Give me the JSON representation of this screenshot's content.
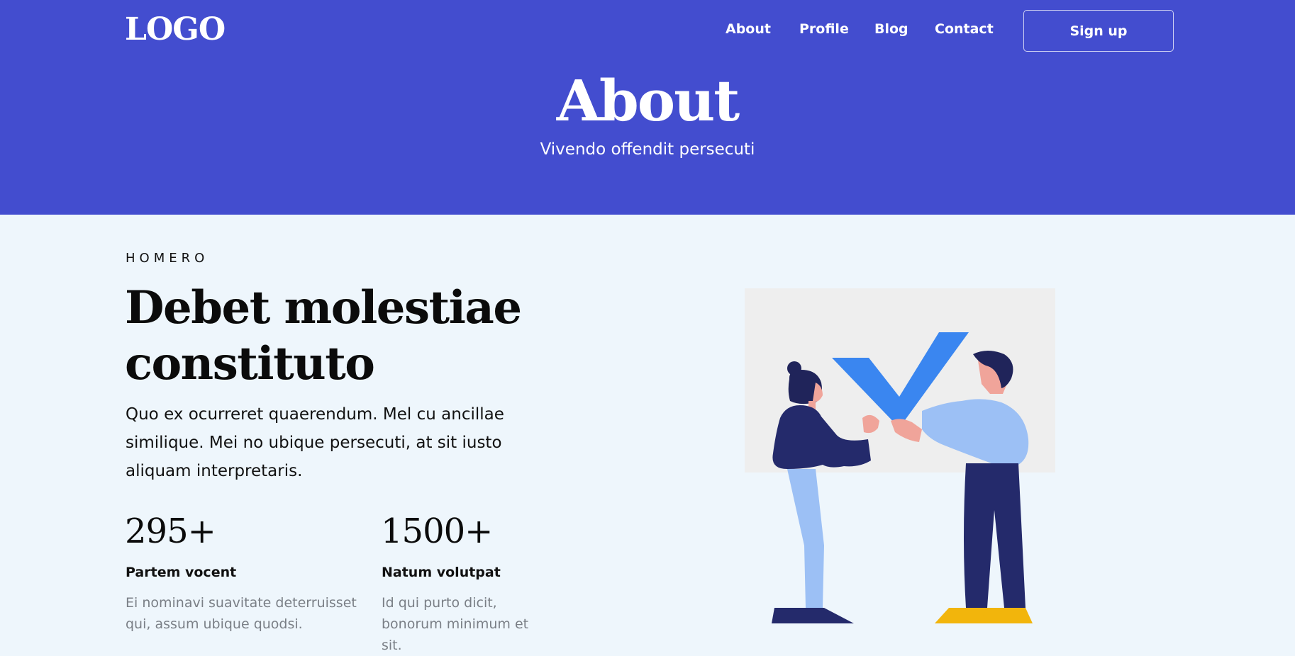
{
  "header": {
    "logo": "LOGO",
    "nav": [
      "About",
      "Profile",
      "Blog",
      "Contact"
    ],
    "signup_label": "Sign up"
  },
  "hero": {
    "title": "About",
    "subtitle": "Vivendo offendit persecuti"
  },
  "section": {
    "eyebrow": "HOMERO",
    "headline_line1": "Debet molestiae",
    "headline_line2": "constituto",
    "lede": "Quo ex ocurreret quaerendum. Mel cu ancillae similique. Mei no ubique persecuti, at sit iusto aliquam interpretaris."
  },
  "stats": [
    {
      "number": "295+",
      "label": "Partem vocent",
      "text": "Ei nominavi suavitate deterruisset qui, assum ubique quodsi."
    },
    {
      "number": "1500+",
      "label": "Natum volutpat",
      "text": "Id qui purto dicit, bonorum minimum et sit."
    }
  ],
  "colors": {
    "hero_bg": "#434dcf",
    "page_bg": "#eef6fc",
    "check_blue": "#3a86f0",
    "dark_navy": "#242a6b",
    "light_blue": "#9cc0f5",
    "shoe_yellow": "#f2b50c"
  },
  "icons": {
    "illustration": "two-people-holding-checkmark-illustration"
  }
}
